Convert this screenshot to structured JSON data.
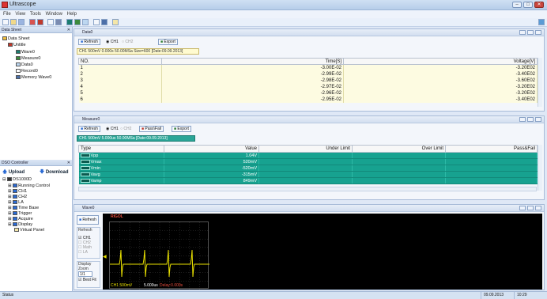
{
  "app": {
    "title": "Ultrascope"
  },
  "menu": [
    "File",
    "View",
    "Tools",
    "Window",
    "Help"
  ],
  "data_sheet_panel": {
    "header": "Data Sheet",
    "tree": [
      {
        "label": "Data Sheet",
        "level": 0
      },
      {
        "label": "Untitle",
        "level": 1
      },
      {
        "label": "Wave0",
        "level": 2
      },
      {
        "label": "Measure0",
        "level": 2
      },
      {
        "label": "Data0",
        "level": 2
      },
      {
        "label": "Record0",
        "level": 2
      },
      {
        "label": "Memory Wave0",
        "level": 2
      }
    ]
  },
  "dso_controller": {
    "header": "DSO Controller",
    "upload": "Upload",
    "download": "Download",
    "tree": [
      {
        "label": "DS1000D",
        "level": 0
      },
      {
        "label": "Running Control",
        "level": 1
      },
      {
        "label": "CH1",
        "level": 1
      },
      {
        "label": "CH2",
        "level": 1
      },
      {
        "label": "LA",
        "level": 1
      },
      {
        "label": "Time Base",
        "level": 1
      },
      {
        "label": "Trigger",
        "level": 1
      },
      {
        "label": "Acquire",
        "level": 1
      },
      {
        "label": "Display",
        "level": 1
      },
      {
        "label": "Virtual Panel",
        "level": 1
      }
    ]
  },
  "data0": {
    "title": "Data0",
    "refresh": "Refresh",
    "ch1": "CH1",
    "ch2": "CH2",
    "export": "Export",
    "info": "CH1 500mV  0.000s 50.00MSa  Size=600  [Date:09.09.2013]",
    "columns": [
      "NO.",
      "Time[S]",
      "Voltage[V]"
    ],
    "rows": [
      [
        "1",
        "-3.00E-02",
        "-3.20E02"
      ],
      [
        "2",
        "-2.99E-02",
        "-3.40E02"
      ],
      [
        "3",
        "-2.98E-02",
        "-3.60E02"
      ],
      [
        "4",
        "-2.97E-02",
        "-3.20E02"
      ],
      [
        "5",
        "-2.96E-02",
        "-3.20E02"
      ],
      [
        "6",
        "-2.95E-02",
        "-3.40E02"
      ]
    ]
  },
  "measure0": {
    "title": "Measure0",
    "refresh": "Refresh",
    "ch1": "CH1",
    "ch2": "CH2",
    "passfail": "Pass\\Fail",
    "export": "Export",
    "info": "CH1 500mV  5.000us 50.00MSa  [Date:09.09.2013]",
    "columns": [
      "Type",
      "Value",
      "Under Limit",
      "Over Limit",
      "Pass&Fail"
    ],
    "rows": [
      [
        "Vpp",
        "1.04V"
      ],
      [
        "Vmax",
        "520mV"
      ],
      [
        "Vmin",
        "-520mV"
      ],
      [
        "Vavg",
        "-315mV"
      ],
      [
        "Vamp",
        "849mV"
      ]
    ]
  },
  "wave0": {
    "title": "Wave0",
    "refresh": "Refresh",
    "refresh_group": "Refresh",
    "channels": [
      "CH1",
      "CH2",
      "Math",
      "LA"
    ],
    "display_group": "Display",
    "zoom_label": "Zoom",
    "zoom_value": "1/1",
    "bestfit": "Best Fit",
    "scope_status": "RIGOL",
    "scope_ch_label": "CH1 500mV",
    "scope_time_label": "5.000us",
    "scope_time_extra": "Delay:0.000s"
  },
  "status": {
    "left": "Status",
    "date": "09.09.2013",
    "time": "10:29"
  },
  "colors": {
    "teal": "#17a290",
    "scope_trace": "#e8e000",
    "yellow_row": "#fdfbe1"
  }
}
